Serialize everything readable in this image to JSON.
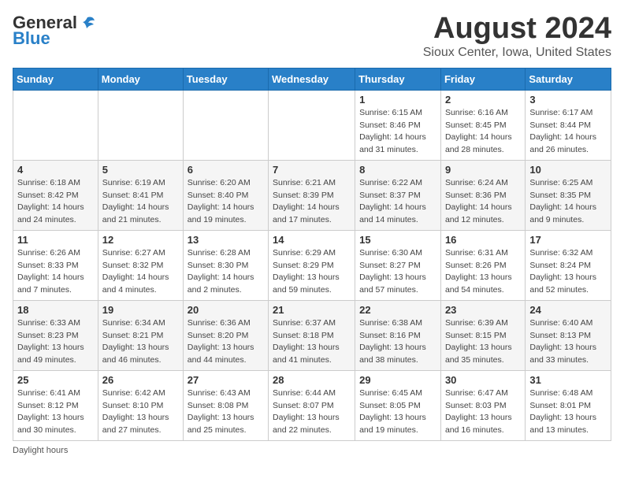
{
  "header": {
    "logo_general": "General",
    "logo_blue": "Blue",
    "month_title": "August 2024",
    "location": "Sioux Center, Iowa, United States"
  },
  "days_of_week": [
    "Sunday",
    "Monday",
    "Tuesday",
    "Wednesday",
    "Thursday",
    "Friday",
    "Saturday"
  ],
  "weeks": [
    [
      {
        "day": "",
        "detail": ""
      },
      {
        "day": "",
        "detail": ""
      },
      {
        "day": "",
        "detail": ""
      },
      {
        "day": "",
        "detail": ""
      },
      {
        "day": "1",
        "detail": "Sunrise: 6:15 AM\nSunset: 8:46 PM\nDaylight: 14 hours and 31 minutes."
      },
      {
        "day": "2",
        "detail": "Sunrise: 6:16 AM\nSunset: 8:45 PM\nDaylight: 14 hours and 28 minutes."
      },
      {
        "day": "3",
        "detail": "Sunrise: 6:17 AM\nSunset: 8:44 PM\nDaylight: 14 hours and 26 minutes."
      }
    ],
    [
      {
        "day": "4",
        "detail": "Sunrise: 6:18 AM\nSunset: 8:42 PM\nDaylight: 14 hours and 24 minutes."
      },
      {
        "day": "5",
        "detail": "Sunrise: 6:19 AM\nSunset: 8:41 PM\nDaylight: 14 hours and 21 minutes."
      },
      {
        "day": "6",
        "detail": "Sunrise: 6:20 AM\nSunset: 8:40 PM\nDaylight: 14 hours and 19 minutes."
      },
      {
        "day": "7",
        "detail": "Sunrise: 6:21 AM\nSunset: 8:39 PM\nDaylight: 14 hours and 17 minutes."
      },
      {
        "day": "8",
        "detail": "Sunrise: 6:22 AM\nSunset: 8:37 PM\nDaylight: 14 hours and 14 minutes."
      },
      {
        "day": "9",
        "detail": "Sunrise: 6:24 AM\nSunset: 8:36 PM\nDaylight: 14 hours and 12 minutes."
      },
      {
        "day": "10",
        "detail": "Sunrise: 6:25 AM\nSunset: 8:35 PM\nDaylight: 14 hours and 9 minutes."
      }
    ],
    [
      {
        "day": "11",
        "detail": "Sunrise: 6:26 AM\nSunset: 8:33 PM\nDaylight: 14 hours and 7 minutes."
      },
      {
        "day": "12",
        "detail": "Sunrise: 6:27 AM\nSunset: 8:32 PM\nDaylight: 14 hours and 4 minutes."
      },
      {
        "day": "13",
        "detail": "Sunrise: 6:28 AM\nSunset: 8:30 PM\nDaylight: 14 hours and 2 minutes."
      },
      {
        "day": "14",
        "detail": "Sunrise: 6:29 AM\nSunset: 8:29 PM\nDaylight: 13 hours and 59 minutes."
      },
      {
        "day": "15",
        "detail": "Sunrise: 6:30 AM\nSunset: 8:27 PM\nDaylight: 13 hours and 57 minutes."
      },
      {
        "day": "16",
        "detail": "Sunrise: 6:31 AM\nSunset: 8:26 PM\nDaylight: 13 hours and 54 minutes."
      },
      {
        "day": "17",
        "detail": "Sunrise: 6:32 AM\nSunset: 8:24 PM\nDaylight: 13 hours and 52 minutes."
      }
    ],
    [
      {
        "day": "18",
        "detail": "Sunrise: 6:33 AM\nSunset: 8:23 PM\nDaylight: 13 hours and 49 minutes."
      },
      {
        "day": "19",
        "detail": "Sunrise: 6:34 AM\nSunset: 8:21 PM\nDaylight: 13 hours and 46 minutes."
      },
      {
        "day": "20",
        "detail": "Sunrise: 6:36 AM\nSunset: 8:20 PM\nDaylight: 13 hours and 44 minutes."
      },
      {
        "day": "21",
        "detail": "Sunrise: 6:37 AM\nSunset: 8:18 PM\nDaylight: 13 hours and 41 minutes."
      },
      {
        "day": "22",
        "detail": "Sunrise: 6:38 AM\nSunset: 8:16 PM\nDaylight: 13 hours and 38 minutes."
      },
      {
        "day": "23",
        "detail": "Sunrise: 6:39 AM\nSunset: 8:15 PM\nDaylight: 13 hours and 35 minutes."
      },
      {
        "day": "24",
        "detail": "Sunrise: 6:40 AM\nSunset: 8:13 PM\nDaylight: 13 hours and 33 minutes."
      }
    ],
    [
      {
        "day": "25",
        "detail": "Sunrise: 6:41 AM\nSunset: 8:12 PM\nDaylight: 13 hours and 30 minutes."
      },
      {
        "day": "26",
        "detail": "Sunrise: 6:42 AM\nSunset: 8:10 PM\nDaylight: 13 hours and 27 minutes."
      },
      {
        "day": "27",
        "detail": "Sunrise: 6:43 AM\nSunset: 8:08 PM\nDaylight: 13 hours and 25 minutes."
      },
      {
        "day": "28",
        "detail": "Sunrise: 6:44 AM\nSunset: 8:07 PM\nDaylight: 13 hours and 22 minutes."
      },
      {
        "day": "29",
        "detail": "Sunrise: 6:45 AM\nSunset: 8:05 PM\nDaylight: 13 hours and 19 minutes."
      },
      {
        "day": "30",
        "detail": "Sunrise: 6:47 AM\nSunset: 8:03 PM\nDaylight: 13 hours and 16 minutes."
      },
      {
        "day": "31",
        "detail": "Sunrise: 6:48 AM\nSunset: 8:01 PM\nDaylight: 13 hours and 13 minutes."
      }
    ]
  ],
  "footer_note": "Daylight hours"
}
